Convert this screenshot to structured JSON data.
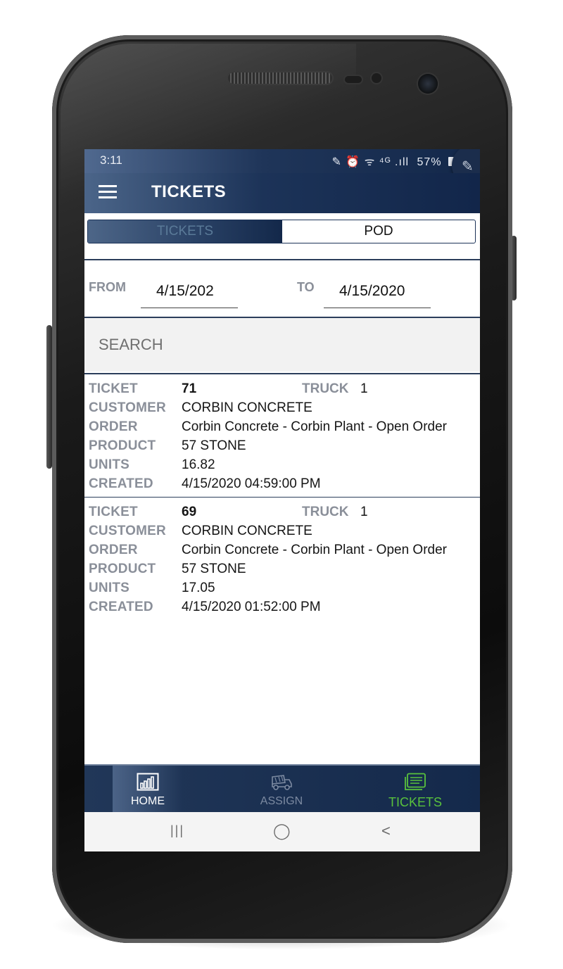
{
  "status_bar": {
    "time": "3:11",
    "icons_text": "✎ ⏰ ᯤ ⁴ᴳ .ıll",
    "battery": "57%"
  },
  "app_bar": {
    "title": "TICKETS"
  },
  "toggle": {
    "tickets_label": "TICKETS",
    "pod_label": "POD",
    "selected": "TICKETS"
  },
  "date_filter": {
    "from_label": "FROM",
    "from_value": "4/15/202",
    "to_label": "TO",
    "to_value": "4/15/2020"
  },
  "search": {
    "placeholder": "SEARCH"
  },
  "labels": {
    "ticket": "TICKET",
    "truck": "TRUCK",
    "customer": "CUSTOMER",
    "order": "ORDER",
    "product": "PRODUCT",
    "units": "UNITS",
    "created": "CREATED"
  },
  "tickets": [
    {
      "ticket": "71",
      "truck": "1",
      "customer": "CORBIN CONCRETE",
      "order": "Corbin Concrete - Corbin Plant - Open Order",
      "product": "57 STONE",
      "units": "16.82",
      "created": "4/15/2020 04:59:00 PM"
    },
    {
      "ticket": "69",
      "truck": "1",
      "customer": "CORBIN CONCRETE",
      "order": "Corbin Concrete - Corbin Plant - Open Order",
      "product": "57 STONE",
      "units": "17.05",
      "created": "4/15/2020 01:52:00 PM"
    }
  ],
  "bottom_nav": {
    "home": "HOME",
    "assign": "ASSIGN",
    "tickets": "TICKETS",
    "active": "TICKETS",
    "active_color": "#59c13d"
  },
  "system_nav": {
    "recents": "|||",
    "home": "◯",
    "back": "<"
  },
  "colors": {
    "navy": "#13284a",
    "label_gray": "#8a8f99"
  }
}
